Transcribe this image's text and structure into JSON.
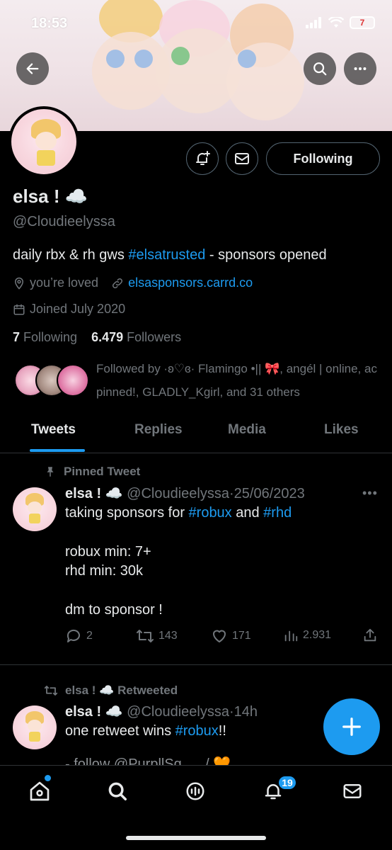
{
  "status": {
    "time": "18:53",
    "battery": "7"
  },
  "profile": {
    "name": "elsa ! ☁️",
    "handle": "@Cloudieelyssa",
    "bio_text": "daily rbx & rh gws ",
    "bio_hashtag": "#elsatrusted",
    "bio_suffix": " - sponsors opened",
    "location": "you’re loved",
    "website": "elsasponsors.carrd.co",
    "joined": "Joined July 2020",
    "following_count": "7",
    "following_label": "Following",
    "followers_count": "6.479",
    "followers_label": "Followers",
    "followed_by": "Followed by ·ʚ♡ɞ· Flamingo •|| 🎀, angél | online, ac pinned!, GLADLY_Kgirl, and 31 others",
    "following_button": "Following"
  },
  "tabs": [
    "Tweets",
    "Replies",
    "Media",
    "Likes"
  ],
  "tweets": [
    {
      "label": "Pinned Tweet",
      "name": "elsa ! ☁️",
      "handle": "@Cloudieelyssa",
      "date": "·25/06/2023",
      "line1_a": "taking sponsors for ",
      "line1_tag1": "#robux",
      "line1_b": " and ",
      "line1_tag2": "#rhd",
      "line2": "robux min: 7+",
      "line3": "rhd min: 30k",
      "line4": "dm to sponsor !",
      "replies": "2",
      "retweets": "143",
      "likes": "171",
      "views": "2.931"
    },
    {
      "label": "elsa ! ☁️ Retweeted",
      "name": "elsa ! ☁️",
      "handle": "@Cloudieelyssa",
      "date": "·14h",
      "line1_a": "one retweet wins ",
      "line1_tag1": "#robux",
      "line1_b": "!!",
      "peek": "- follow @PurpllSq_... / 🧡"
    }
  ],
  "nav": {
    "notifications_badge": "19"
  },
  "icons": {
    "back": "arrow-left-icon",
    "search": "search-icon",
    "more": "more-icon",
    "notify": "bell-plus-icon",
    "message": "mail-icon"
  },
  "colors": {
    "accent": "#1d9bf0",
    "bg": "#000000",
    "secondary_text": "#71767b"
  }
}
